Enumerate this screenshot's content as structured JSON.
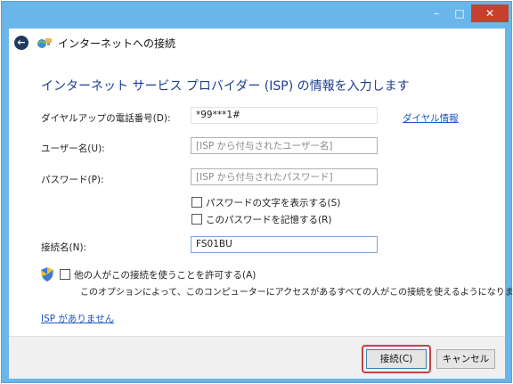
{
  "window": {
    "minimize_glyph": "–",
    "maximize_glyph": "□",
    "close_glyph": "✕"
  },
  "header": {
    "back_glyph": "←",
    "title": "インターネットへの接続",
    "icon": "network-globe-icon"
  },
  "instruction": "インターネット サービス プロバイダー (ISP) の情報を入力します",
  "form": {
    "phone": {
      "label": "ダイヤルアップの電話番号(D):",
      "value": "*99***1#"
    },
    "dial_rules_link": "ダイヤル情報",
    "username": {
      "label": "ユーザー名(U):",
      "placeholder": "[ISP から付与されたユーザー名]"
    },
    "password": {
      "label": "パスワード(P):",
      "placeholder": "[ISP から付与されたパスワード]"
    },
    "show_chars": {
      "label": "パスワードの文字を表示する(S)",
      "checked": false
    },
    "remember": {
      "label": "このパスワードを記憶する(R)",
      "checked": false
    },
    "connection_name": {
      "label": "接続名(N):",
      "value": "FS01BU"
    },
    "allow_others": {
      "label": "他の人がこの接続を使うことを許可する(A)",
      "checked": false,
      "icon": "uac-shield-icon"
    },
    "allow_others_note": "このオプションによって、このコンピューターにアクセスがあるすべての人がこの接続を使えるようになります。",
    "no_isp_link": "ISP がありません"
  },
  "footer": {
    "connect_label": "接続(C)",
    "cancel_label": "キャンセル"
  },
  "colors": {
    "frame": "#6ab6ea",
    "close_button": "#c7402f",
    "instruction_text": "#1d3f8f",
    "link": "#1f57c4",
    "highlight_ring": "#c94048"
  }
}
